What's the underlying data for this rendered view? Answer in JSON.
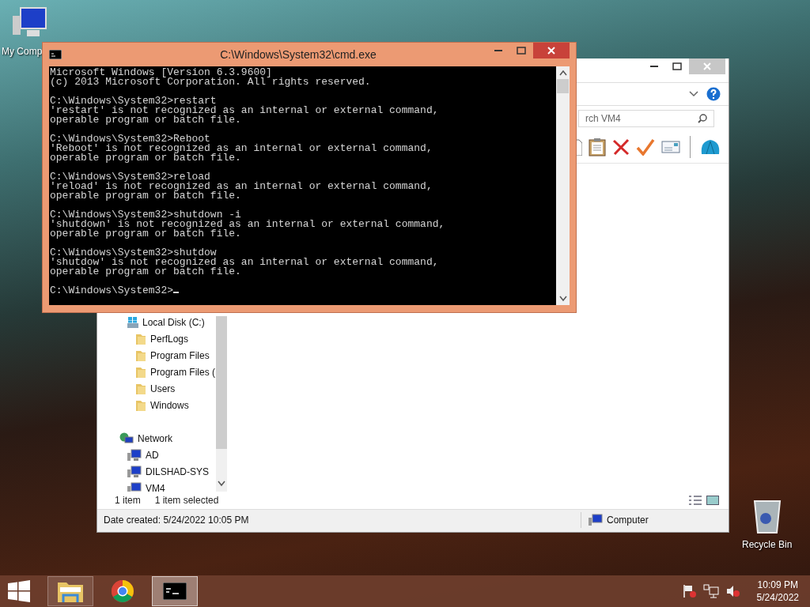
{
  "desktop_icons": [
    {
      "kind": "computer",
      "label": "My Comp"
    },
    {
      "kind": "recycle-bin",
      "label": "Recycle Bin"
    }
  ],
  "explorer": {
    "search": {
      "placeholder": "rch VM4"
    },
    "nav_items": [
      {
        "kind": "drive",
        "label": "Local Disk (C:)",
        "children": [
          {
            "kind": "folder",
            "label": "PerfLogs"
          },
          {
            "kind": "folder",
            "label": "Program Files"
          },
          {
            "kind": "folder",
            "label": "Program Files ("
          },
          {
            "kind": "folder",
            "label": "Users"
          },
          {
            "kind": "folder",
            "label": "Windows"
          }
        ]
      },
      {
        "kind": "network",
        "label": "Network",
        "children": [
          {
            "kind": "pc",
            "label": "AD"
          },
          {
            "kind": "pc",
            "label": "DILSHAD-SYS"
          },
          {
            "kind": "pc",
            "label": "VM4"
          }
        ]
      }
    ],
    "status": {
      "count": "1 item",
      "selection": "1 item selected"
    },
    "details": {
      "date": "Date created: 5/24/2022 10:05 PM",
      "location": "Computer"
    }
  },
  "cmd": {
    "title": "C:\\Windows\\System32\\cmd.exe",
    "blocks": [
      {
        "lines": [
          "Microsoft Windows [Version 6.3.9600]",
          "(c) 2013 Microsoft Corporation. All rights reserved."
        ]
      },
      {
        "lines": [
          "C:\\Windows\\System32>restart",
          "'restart' is not recognized as an internal or external command,",
          "operable program or batch file."
        ]
      },
      {
        "lines": [
          "C:\\Windows\\System32>Reboot",
          "'Reboot' is not recognized as an internal or external command,",
          "operable program or batch file."
        ]
      },
      {
        "lines": [
          "C:\\Windows\\System32>reload",
          "'reload' is not recognized as an internal or external command,",
          "operable program or batch file."
        ]
      },
      {
        "lines": [
          "C:\\Windows\\System32>shutdown -i",
          "'shutdown' is not recognized as an internal or external command,",
          "operable program or batch file."
        ]
      },
      {
        "lines": [
          "C:\\Windows\\System32>shutdow",
          "'shutdow' is not recognized as an internal or external command,",
          "operable program or batch file."
        ]
      },
      {
        "lines": [
          "C:\\Windows\\System32>"
        ]
      }
    ]
  },
  "taskbar": {
    "apps": [
      {
        "kind": "explorer",
        "open": true,
        "selected": false
      },
      {
        "kind": "chrome",
        "open": false,
        "selected": false
      },
      {
        "kind": "cmd",
        "open": true,
        "selected": true
      }
    ],
    "clock": {
      "time": "10:09 PM",
      "date": "5/24/2022"
    }
  }
}
